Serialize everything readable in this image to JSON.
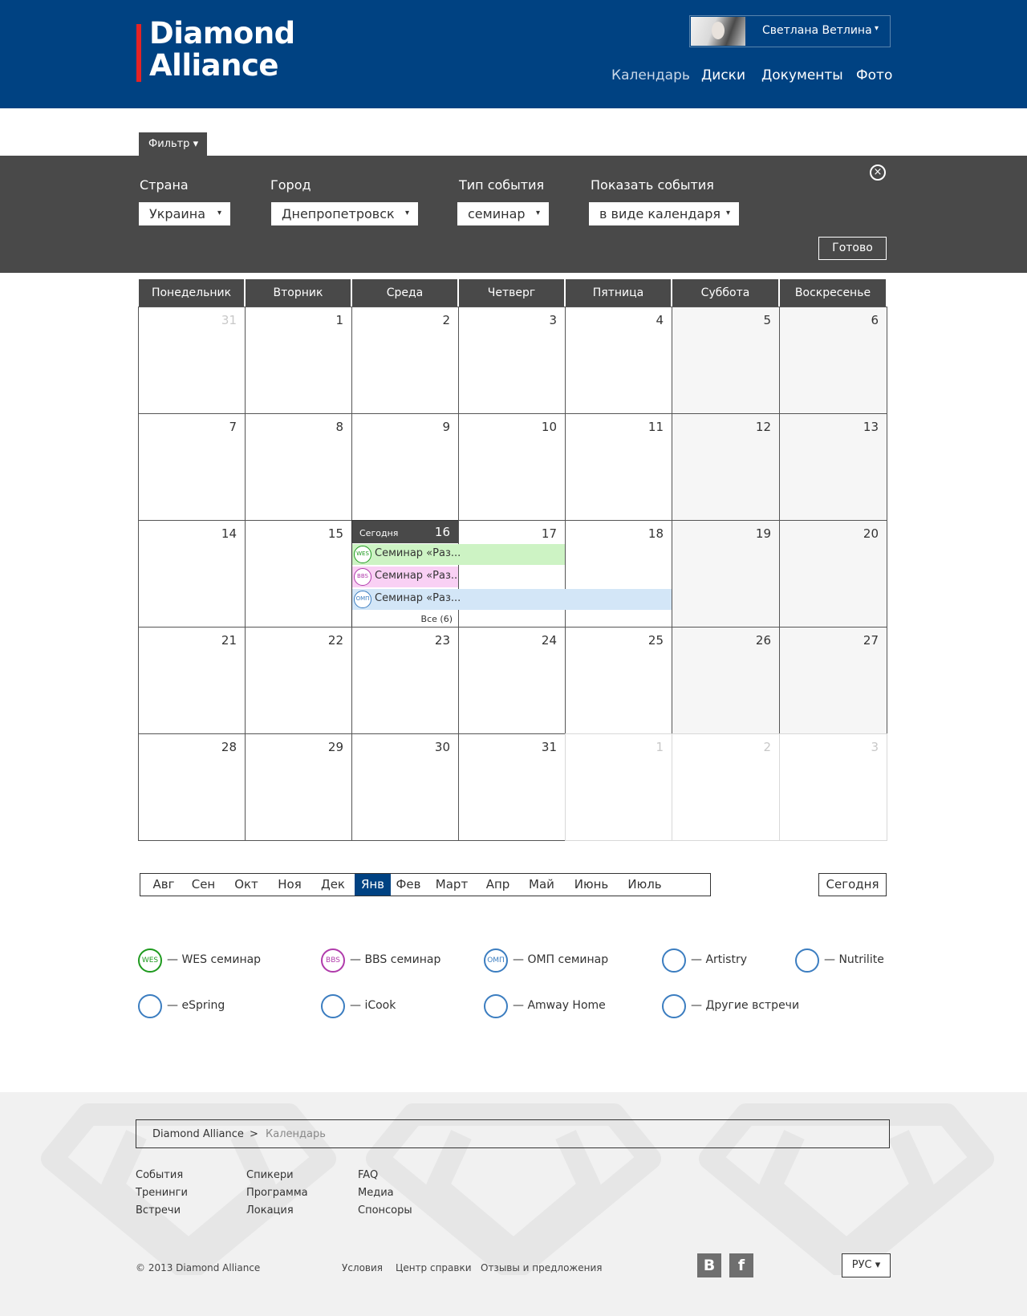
{
  "brand": {
    "line1": "Diamond",
    "line2": "Alliance",
    "accent": "#e52325",
    "primary": "#004282"
  },
  "user": {
    "name": "Светлана Ветлина",
    "caret": "▾"
  },
  "nav": [
    "Календарь",
    "Диски",
    "Документы",
    "Фото"
  ],
  "filter": {
    "tab_label": "Фильтр ▾",
    "country_label": "Страна",
    "country_value": "Украина",
    "city_label": "Город",
    "city_value": "Днепропетровск",
    "type_label": "Тип события",
    "type_value": "семинар",
    "show_label": "Показать события",
    "show_value": "в виде календаря",
    "done_label": "Готово",
    "caret": "▾",
    "close_icon": "×"
  },
  "calendar": {
    "weekdays": [
      "Понедельник",
      "Вторник",
      "Среда",
      "Четверг",
      "Пятница",
      "Суббота",
      "Воскресенье"
    ],
    "weeks": [
      [
        "31",
        "1",
        "2",
        "3",
        "4",
        "5",
        "6"
      ],
      [
        "7",
        "8",
        "9",
        "10",
        "11",
        "12",
        "13"
      ],
      [
        "14",
        "15",
        "16",
        "17",
        "18",
        "19",
        "20"
      ],
      [
        "21",
        "22",
        "23",
        "24",
        "25",
        "26",
        "27"
      ],
      [
        "28",
        "29",
        "30",
        "31",
        "1",
        "2",
        "3"
      ]
    ],
    "today_label": "Сегодня",
    "today_day": "16",
    "events": [
      {
        "badge": "WES",
        "title": "Семинар «Раз...",
        "color": "#cdf3c4",
        "border": "#1e9a1e"
      },
      {
        "badge": "BBS",
        "title": "Семинар «Раз...",
        "color": "#f9d0f4",
        "border": "#b03bab"
      },
      {
        "badge": "ОМП",
        "title": "Семинар «Раз...",
        "color": "#d3e6f7",
        "border": "#3b7dc0"
      }
    ],
    "all_link": "Все (6)"
  },
  "months": [
    "Авг",
    "Сен",
    "Окт",
    "Ноя",
    "Дек",
    "Янв",
    "Фев",
    "Март",
    "Апр",
    "Май",
    "Июнь",
    "Июль"
  ],
  "active_month": "Янв",
  "today_button": "Сегодня",
  "legend": [
    {
      "badge": "WES",
      "label": "— WES семинар",
      "color": "#1e9a1e"
    },
    {
      "badge": "BBS",
      "label": "— BBS семинар",
      "color": "#b03bab"
    },
    {
      "badge": "ОМП",
      "label": "— ОМП семинар",
      "color": "#3b7dc0"
    },
    {
      "badge": "",
      "label": "— Artistry",
      "color": "#3b7dc0"
    },
    {
      "badge": "",
      "label": "— Nutrilite",
      "color": "#3b7dc0"
    },
    {
      "badge": "",
      "label": "— eSpring",
      "color": "#3b7dc0"
    },
    {
      "badge": "",
      "label": "— iCook",
      "color": "#3b7dc0"
    },
    {
      "badge": "",
      "label": "— Amway Home",
      "color": "#3b7dc0"
    },
    {
      "badge": "",
      "label": "— Другие встречи",
      "color": "#3b7dc0"
    }
  ],
  "footer": {
    "breadcrumb": {
      "home": "Diamond Alliance",
      "sep": ">",
      "current": "Календарь"
    },
    "col1": [
      "События",
      "Тренинги",
      "Встречи"
    ],
    "col2": [
      "Спикери",
      "Программа",
      "Локация"
    ],
    "col3": [
      "FAQ",
      "Медиа",
      "Спонсоры"
    ],
    "copyright": "© 2013 Diamond Alliance",
    "bottom_links": [
      "Условия",
      "Центр справки",
      "Отзывы и предложения"
    ],
    "social": [
      "B",
      "f"
    ],
    "social_icons": [
      "vk-icon",
      "facebook-icon"
    ],
    "lang": "РУС ▾"
  }
}
